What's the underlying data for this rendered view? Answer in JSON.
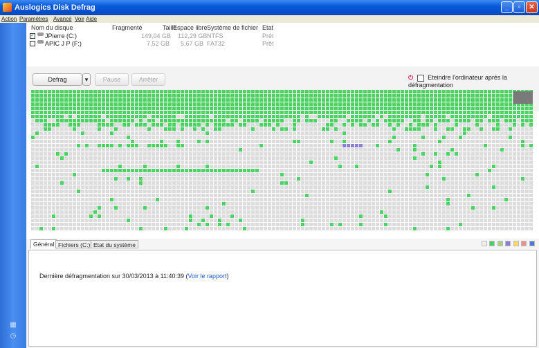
{
  "window": {
    "title": "Auslogics Disk Defrag"
  },
  "menu": [
    "Action",
    "Paramètres",
    "Avancé",
    "Voir",
    "Aide"
  ],
  "disks": {
    "headers": [
      "Nom du disque",
      "Fragmenté",
      "Taille",
      "Espace libre",
      "Système de fichier",
      "Etat"
    ],
    "rows": [
      {
        "checked": true,
        "name": "JPierre (C:)",
        "fragmented": "",
        "size": "149,04 GB",
        "free": "112,29 GB",
        "fs": "NTFS",
        "state": "Prêt"
      },
      {
        "checked": false,
        "name": "APIC J P (F:)",
        "fragmented": "",
        "size": "7,52 GB",
        "free": "5,67 GB",
        "fs": "FAT32",
        "state": "Prêt"
      }
    ]
  },
  "toolbar": {
    "defrag": "Defrag",
    "pause": "Pause",
    "stop": "Arrêter",
    "shutdown": "Eteindre l'ordinateur après la défragmentation"
  },
  "tabs": [
    "Général",
    "Fichiers (C:)",
    "Etat du système"
  ],
  "general": {
    "last_defrag": "Dernière défragmentation sur 30/03/2013 à 11:40:39 (",
    "report_link": "Voir le rapport",
    "close_paren": ")"
  },
  "colors": {
    "used": "#4cd163",
    "free": "#dcdcdc",
    "fragmented": "#8a7fd4",
    "titlebar": "#0a5ad8"
  }
}
